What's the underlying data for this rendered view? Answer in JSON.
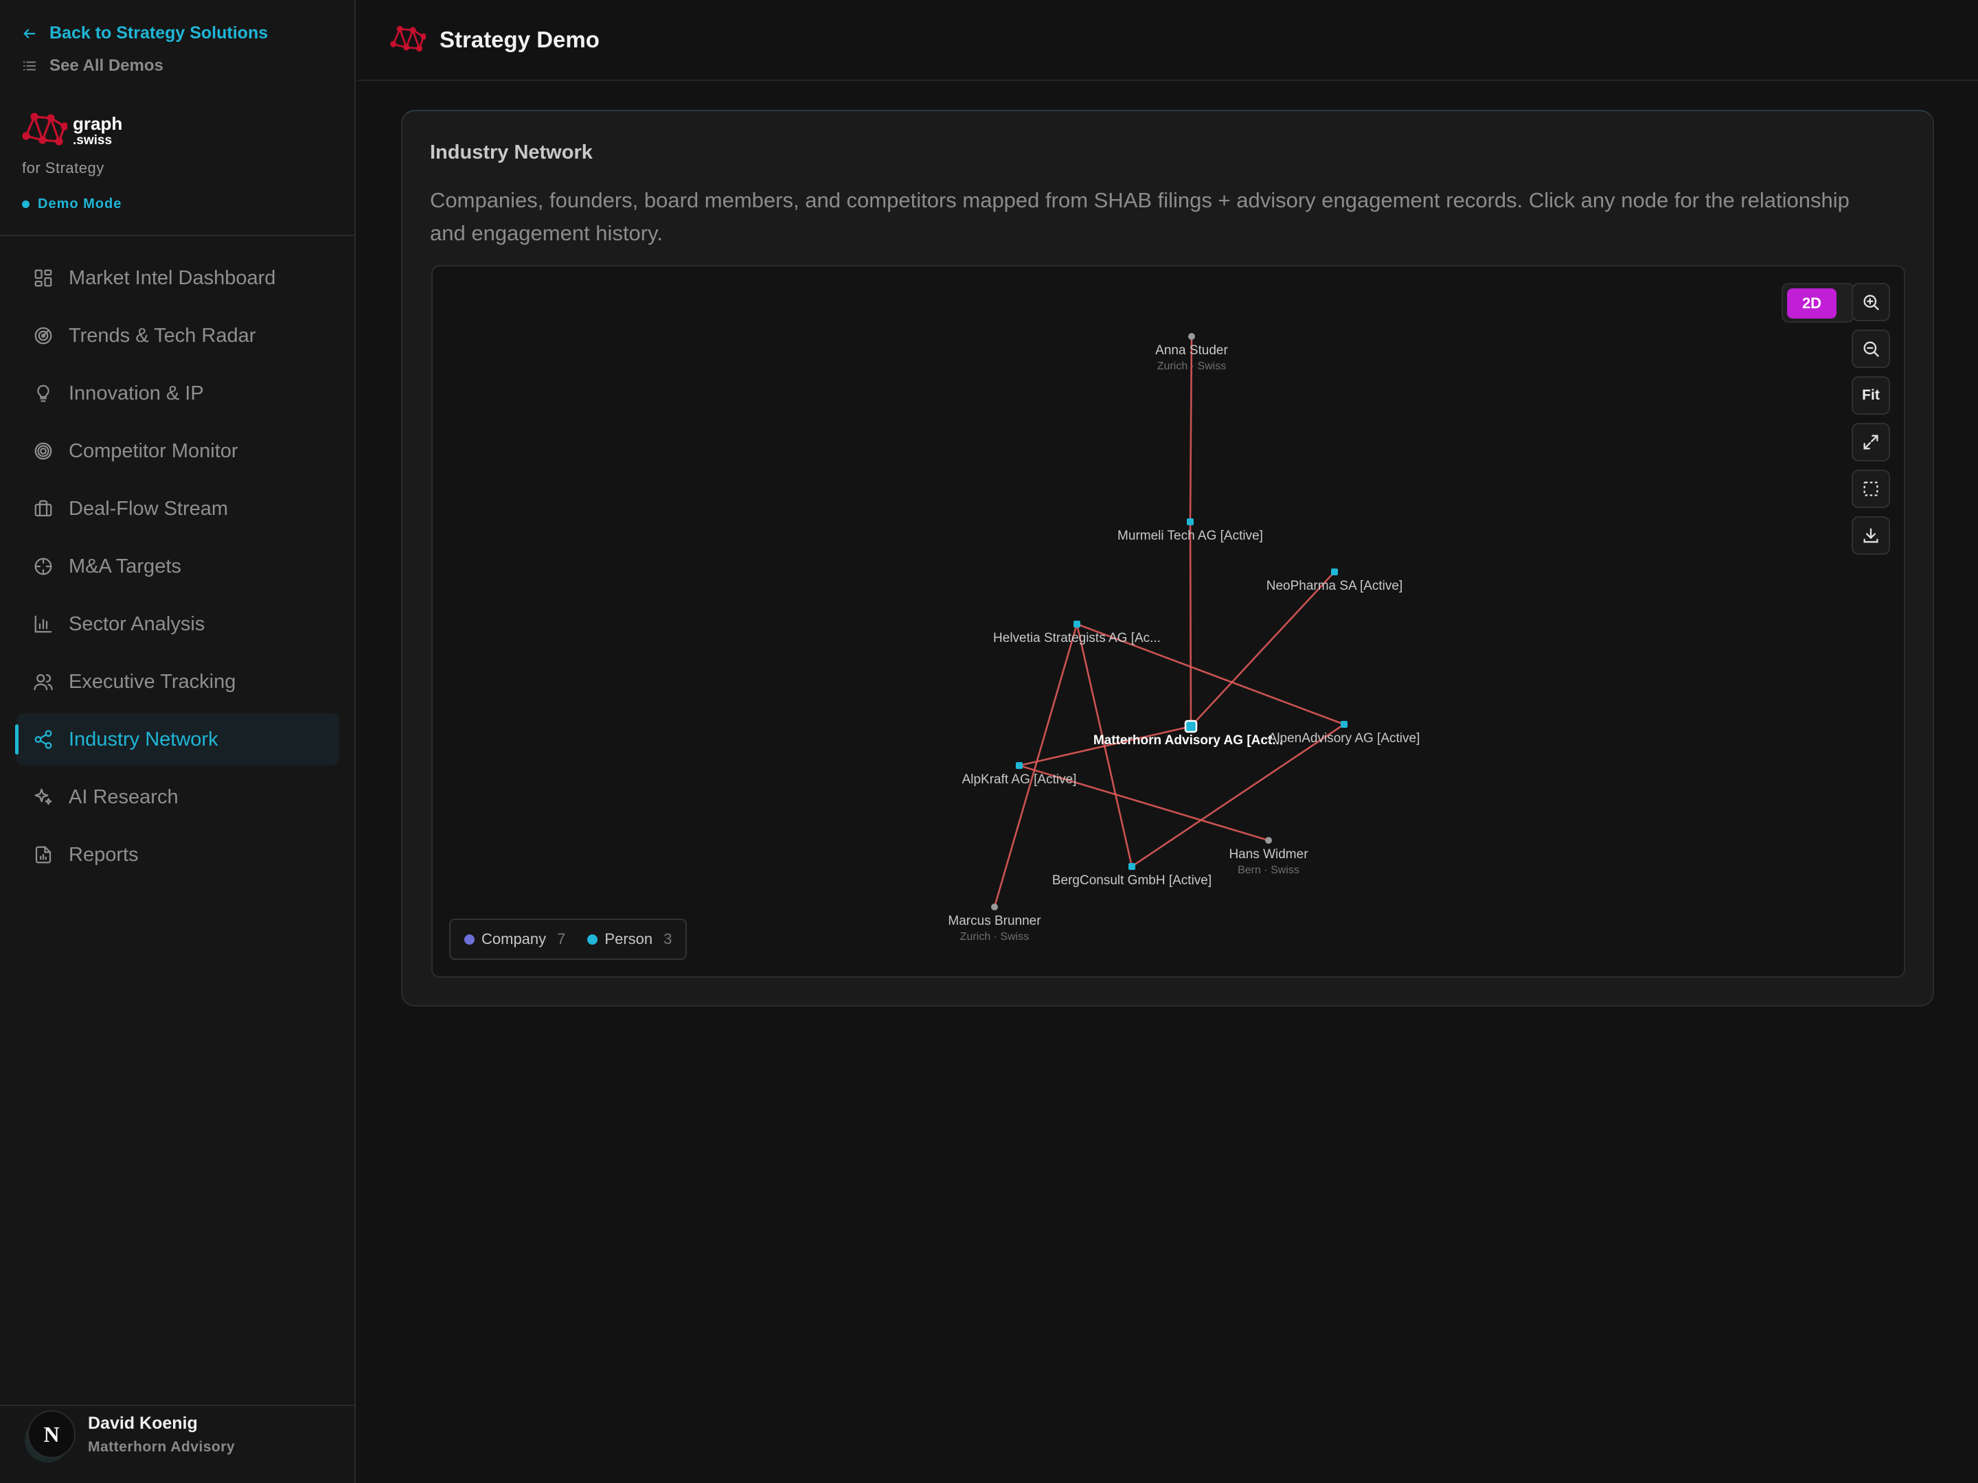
{
  "sidebar": {
    "back_label": "Back to Strategy Solutions",
    "all_demos_label": "See All Demos",
    "brand_line1": "graph",
    "brand_line2": ".swiss",
    "brand_sub": "for Strategy",
    "demo_mode": "Demo Mode",
    "items": [
      {
        "label": "Market Intel Dashboard",
        "icon": "dashboard-grid-icon"
      },
      {
        "label": "Trends & Tech Radar",
        "icon": "radar-icon"
      },
      {
        "label": "Innovation & IP",
        "icon": "lightbulb-icon"
      },
      {
        "label": "Competitor Monitor",
        "icon": "target-icon"
      },
      {
        "label": "Deal-Flow Stream",
        "icon": "briefcase-icon"
      },
      {
        "label": "M&A Targets",
        "icon": "crosshair-icon"
      },
      {
        "label": "Sector Analysis",
        "icon": "bar-chart-icon"
      },
      {
        "label": "Executive Tracking",
        "icon": "users-icon"
      },
      {
        "label": "Industry Network",
        "icon": "share-network-icon",
        "active": true
      },
      {
        "label": "AI Research",
        "icon": "sparkles-icon"
      },
      {
        "label": "Reports",
        "icon": "report-file-icon"
      }
    ],
    "user": {
      "initial": "N",
      "name": "David Koenig",
      "org": "Matterhorn Advisory"
    }
  },
  "header": {
    "title": "Strategy Demo"
  },
  "card": {
    "title": "Industry Network",
    "description": "Companies, founders, board members, and competitors mapped from SHAB filings + advisory engagement records. Click any node for the relationship and engagement history."
  },
  "graph": {
    "mode": "2D",
    "controls": {
      "fit": "Fit"
    },
    "legend": [
      {
        "label": "Company",
        "count": "7",
        "color": "#6b6fd6"
      },
      {
        "label": "Person",
        "count": "3",
        "color": "#1fb6d7"
      }
    ],
    "colors": {
      "edge": "#e05a5a",
      "company_node": "#1fb6d7",
      "person_node": "#9a9a9a"
    },
    "nodes": [
      {
        "id": "anna",
        "label": "Anna Studer",
        "sub": "Zurich · Swiss",
        "type": "person"
      },
      {
        "id": "murmeli",
        "label": "Murmeli Tech AG [Active]",
        "sub": "",
        "type": "company"
      },
      {
        "id": "neopharma",
        "label": "NeoPharma SA [Active]",
        "sub": "",
        "type": "company"
      },
      {
        "id": "helvetia",
        "label": "Helvetia Strategists AG [Ac...",
        "sub": "",
        "type": "company"
      },
      {
        "id": "matterhorn",
        "label": "Matterhorn Advisory AG [Act...",
        "sub": "",
        "type": "company",
        "selected": true
      },
      {
        "id": "alpen",
        "label": "AlpenAdvisory AG [Active]",
        "sub": "",
        "type": "company"
      },
      {
        "id": "alpkraft",
        "label": "AlpKraft AG [Active]",
        "sub": "",
        "type": "company"
      },
      {
        "id": "hans",
        "label": "Hans Widmer",
        "sub": "Bern · Swiss",
        "type": "person"
      },
      {
        "id": "berg",
        "label": "BergConsult GmbH [Active]",
        "sub": "",
        "type": "company"
      },
      {
        "id": "marcus",
        "label": "Marcus Brunner",
        "sub": "Zurich · Swiss",
        "type": "person"
      }
    ],
    "edges": [
      [
        "anna",
        "murmeli"
      ],
      [
        "murmeli",
        "matterhorn"
      ],
      [
        "matterhorn",
        "neopharma"
      ],
      [
        "matterhorn",
        "alpkraft"
      ],
      [
        "helvetia",
        "alpen"
      ],
      [
        "helvetia",
        "berg"
      ],
      [
        "helvetia",
        "marcus"
      ],
      [
        "alpkraft",
        "hans"
      ],
      [
        "berg",
        "alpen"
      ]
    ]
  }
}
